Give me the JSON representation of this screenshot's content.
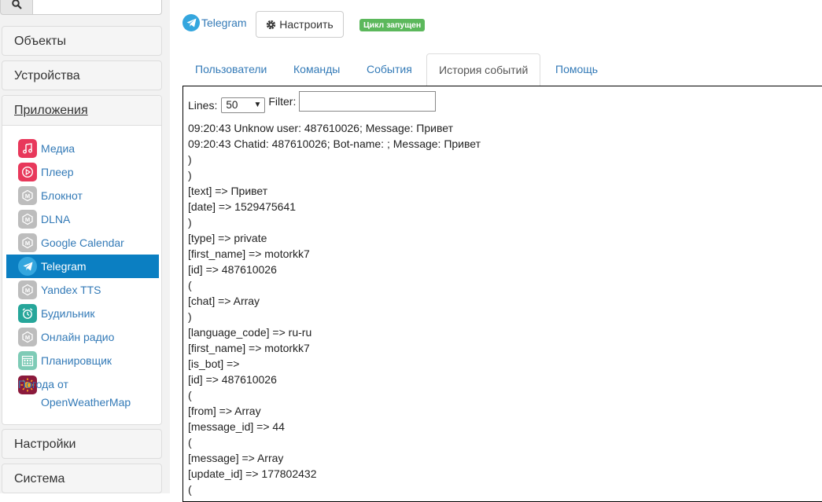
{
  "sidebar": {
    "search_value": "",
    "sections": {
      "objects": "Объекты",
      "devices": "Устройства",
      "apps": "Приложения",
      "settings": "Настройки",
      "system": "Система"
    },
    "apps": [
      {
        "label": "Медиа",
        "icon": "music-note-icon",
        "color": "#e8385b"
      },
      {
        "label": "Плеер",
        "icon": "play-circle-icon",
        "color": "#e8385b"
      },
      {
        "label": "Блокнот",
        "icon": "module-default-icon",
        "color": "#bdbdbd"
      },
      {
        "label": "DLNA",
        "icon": "module-default-icon",
        "color": "#bdbdbd"
      },
      {
        "label": "Google Calendar",
        "icon": "module-default-icon",
        "color": "#bdbdbd"
      },
      {
        "label": "Telegram",
        "icon": "telegram-icon",
        "color": "#34a6de"
      },
      {
        "label": "Yandex TTS",
        "icon": "module-default-icon",
        "color": "#bdbdbd"
      },
      {
        "label": "Будильник",
        "icon": "alarm-clock-icon",
        "color": "#26a69a"
      },
      {
        "label": "Онлайн радио",
        "icon": "module-default-icon",
        "color": "#bdbdbd"
      },
      {
        "label": "Планировщик",
        "icon": "calendar-grid-icon",
        "color": "#7ecbb6"
      },
      {
        "label": "Погода от OpenWeatherMap",
        "icon": "sun-icon",
        "color": "#8b1a3c"
      }
    ]
  },
  "header": {
    "app_title": "Telegram",
    "configure_label": "Настроить",
    "status_badge": "Цикл запущен"
  },
  "tabs": [
    "Пользователи",
    "Команды",
    "События",
    "История событий",
    "Помощь"
  ],
  "log": {
    "lines_label": "Lines:",
    "lines_value": "50",
    "filter_label": "Filter:",
    "filter_value": "",
    "entries": [
      "09:20:43 Unknow user: 487610026; Message: Привет",
      "09:20:43 Chatid: 487610026; Bot-name: ; Message: Привет",
      ")",
      ")",
      "[text] => Привет",
      "[date] => 1529475641",
      ")",
      "[type] => private",
      "[first_name] => motorkk7",
      "[id] => 487610026",
      "(",
      "[chat] => Array",
      ")",
      "[language_code] => ru-ru",
      "[first_name] => motorkk7",
      "[is_bot] =>",
      "[id] => 487610026",
      "(",
      "[from] => Array",
      "[message_id] => 44",
      "(",
      "[message] => Array",
      "[update_id] => 177802432",
      "("
    ]
  }
}
